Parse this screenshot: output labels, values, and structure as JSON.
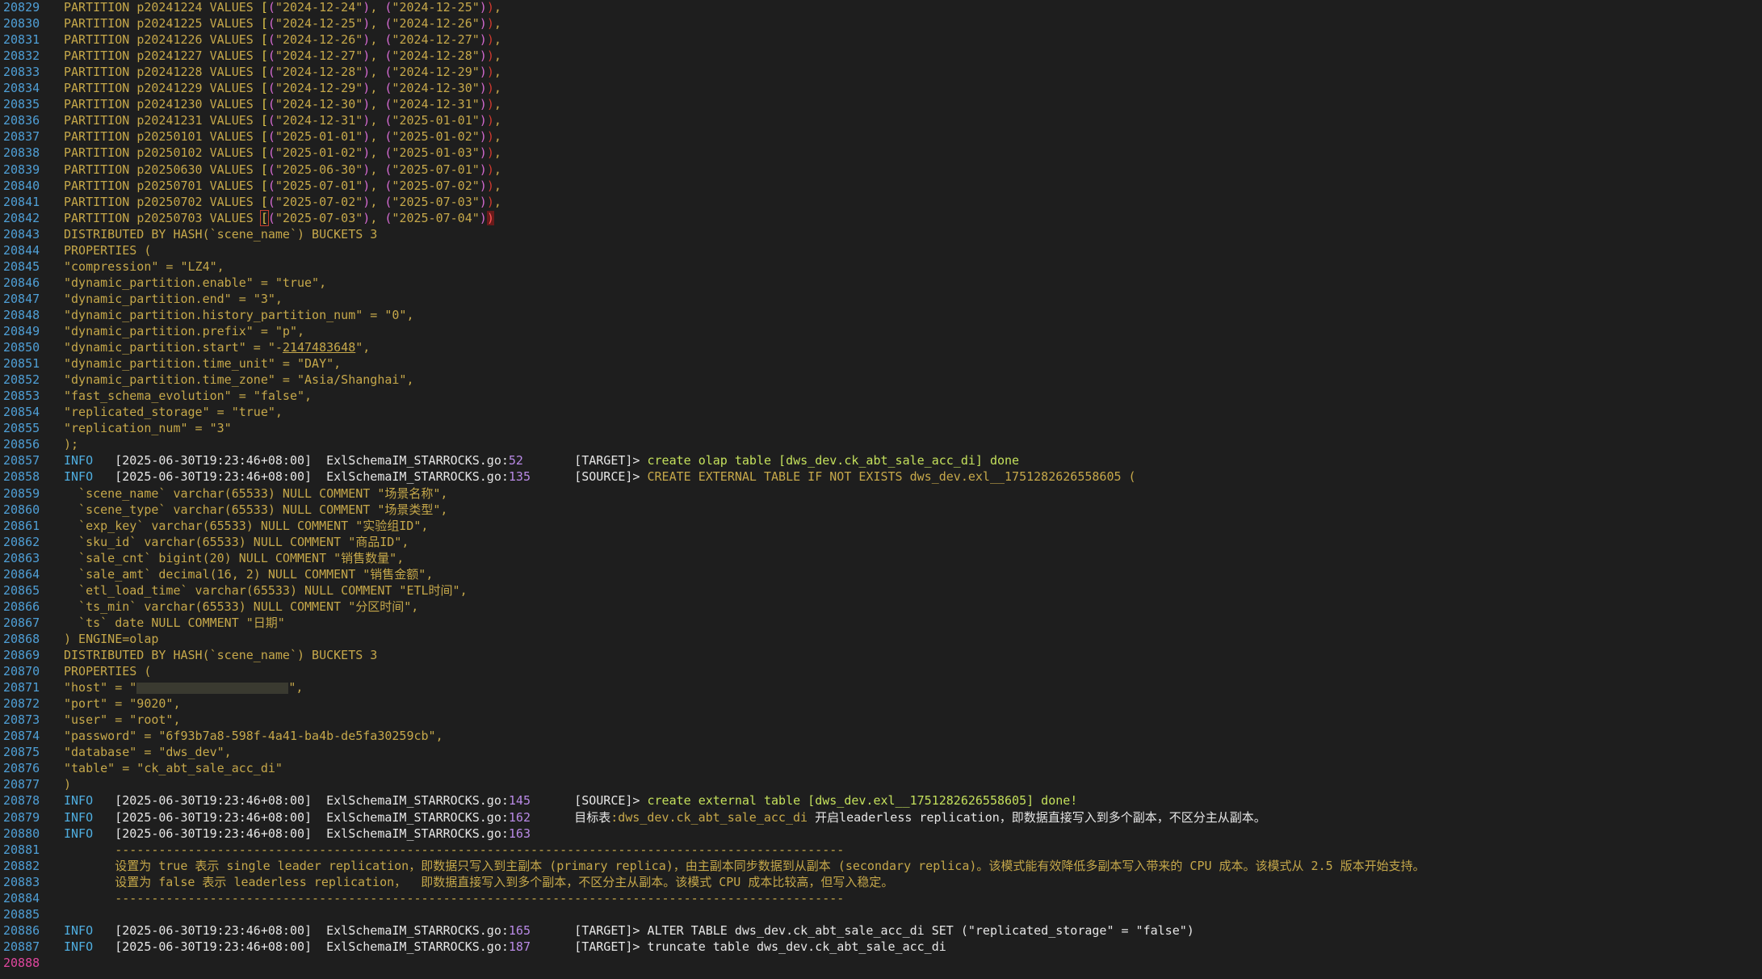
{
  "lines": [
    {
      "n": "20829",
      "kind": "part",
      "name": "p20241224",
      "a": "2024-12-24",
      "b": "2024-12-25"
    },
    {
      "n": "20830",
      "kind": "part",
      "name": "p20241225",
      "a": "2024-12-25",
      "b": "2024-12-26"
    },
    {
      "n": "20831",
      "kind": "part",
      "name": "p20241226",
      "a": "2024-12-26",
      "b": "2024-12-27"
    },
    {
      "n": "20832",
      "kind": "part",
      "name": "p20241227",
      "a": "2024-12-27",
      "b": "2024-12-28"
    },
    {
      "n": "20833",
      "kind": "part",
      "name": "p20241228",
      "a": "2024-12-28",
      "b": "2024-12-29"
    },
    {
      "n": "20834",
      "kind": "part",
      "name": "p20241229",
      "a": "2024-12-29",
      "b": "2024-12-30"
    },
    {
      "n": "20835",
      "kind": "part",
      "name": "p20241230",
      "a": "2024-12-30",
      "b": "2024-12-31"
    },
    {
      "n": "20836",
      "kind": "part",
      "name": "p20241231",
      "a": "2024-12-31",
      "b": "2025-01-01"
    },
    {
      "n": "20837",
      "kind": "part",
      "name": "p20250101",
      "a": "2025-01-01",
      "b": "2025-01-02"
    },
    {
      "n": "20838",
      "kind": "part",
      "name": "p20250102",
      "a": "2025-01-02",
      "b": "2025-01-03"
    },
    {
      "n": "20839",
      "kind": "part",
      "name": "p20250630",
      "a": "2025-06-30",
      "b": "2025-07-01"
    },
    {
      "n": "20840",
      "kind": "part",
      "name": "p20250701",
      "a": "2025-07-01",
      "b": "2025-07-02"
    },
    {
      "n": "20841",
      "kind": "part",
      "name": "p20250702",
      "a": "2025-07-02",
      "b": "2025-07-03"
    },
    {
      "n": "20842",
      "kind": "partlast",
      "name": "p20250703",
      "a": "2025-07-03",
      "b": "2025-07-04"
    },
    {
      "n": "20843",
      "kind": "text",
      "text": "DISTRIBUTED BY HASH(`scene_name`) BUCKETS 3"
    },
    {
      "n": "20844",
      "kind": "text",
      "text": "PROPERTIES ("
    },
    {
      "n": "20845",
      "kind": "text",
      "text": "\"compression\" = \"LZ4\","
    },
    {
      "n": "20846",
      "kind": "text",
      "text": "\"dynamic_partition.enable\" = \"true\","
    },
    {
      "n": "20847",
      "kind": "text",
      "text": "\"dynamic_partition.end\" = \"3\","
    },
    {
      "n": "20848",
      "kind": "text",
      "text": "\"dynamic_partition.history_partition_num\" = \"0\","
    },
    {
      "n": "20849",
      "kind": "text",
      "text": "\"dynamic_partition.prefix\" = \"p\","
    },
    {
      "n": "20850",
      "kind": "start",
      "pre": "\"dynamic_partition.start\" = \"-",
      "num": "2147483648",
      "post": "\","
    },
    {
      "n": "20851",
      "kind": "text",
      "text": "\"dynamic_partition.time_unit\" = \"DAY\","
    },
    {
      "n": "20852",
      "kind": "text",
      "text": "\"dynamic_partition.time_zone\" = \"Asia/Shanghai\","
    },
    {
      "n": "20853",
      "kind": "text",
      "text": "\"fast_schema_evolution\" = \"false\","
    },
    {
      "n": "20854",
      "kind": "text",
      "text": "\"replicated_storage\" = \"true\","
    },
    {
      "n": "20855",
      "kind": "text",
      "text": "\"replication_num\" = \"3\""
    },
    {
      "n": "20856",
      "kind": "text",
      "text": ");"
    },
    {
      "n": "20857",
      "kind": "log",
      "level": "INFO",
      "ts": "[2025-06-30T19:23:46+08:00]",
      "file": "ExlSchemaIM_STARROCKS.go",
      "line": "52",
      "tag": "[TARGET]>",
      "msg": "create olap table [dws_dev.ck_abt_sale_acc_di] done",
      "msgc": "msg-g"
    },
    {
      "n": "20858",
      "kind": "log",
      "level": "INFO",
      "ts": "[2025-06-30T19:23:46+08:00]",
      "file": "ExlSchemaIM_STARROCKS.go",
      "line": "135",
      "tag": "[SOURCE]>",
      "msg": "CREATE EXTERNAL TABLE IF NOT EXISTS dws_dev.exl__1751282626558605 (",
      "msgc": "msg-y"
    },
    {
      "n": "20859",
      "kind": "text",
      "text": "  `scene_name` varchar(65533) NULL COMMENT \"场景名称\","
    },
    {
      "n": "20860",
      "kind": "text",
      "text": "  `scene_type` varchar(65533) NULL COMMENT \"场景类型\","
    },
    {
      "n": "20861",
      "kind": "text",
      "text": "  `exp_key` varchar(65533) NULL COMMENT \"实验组ID\","
    },
    {
      "n": "20862",
      "kind": "text",
      "text": "  `sku_id` varchar(65533) NULL COMMENT \"商品ID\","
    },
    {
      "n": "20863",
      "kind": "text",
      "text": "  `sale_cnt` bigint(20) NULL COMMENT \"销售数量\","
    },
    {
      "n": "20864",
      "kind": "text",
      "text": "  `sale_amt` decimal(16, 2) NULL COMMENT \"销售金额\","
    },
    {
      "n": "20865",
      "kind": "text",
      "text": "  `etl_load_time` varchar(65533) NULL COMMENT \"ETL时间\","
    },
    {
      "n": "20866",
      "kind": "text",
      "text": "  `ts_min` varchar(65533) NULL COMMENT \"分区时间\","
    },
    {
      "n": "20867",
      "kind": "text",
      "text": "  `ts` date NULL COMMENT \"日期\""
    },
    {
      "n": "20868",
      "kind": "text",
      "text": ") ENGINE=olap"
    },
    {
      "n": "20869",
      "kind": "text",
      "text": "DISTRIBUTED BY HASH(`scene_name`) BUCKETS 3"
    },
    {
      "n": "20870",
      "kind": "text",
      "text": "PROPERTIES ("
    },
    {
      "n": "20871",
      "kind": "host",
      "pre": "\"host\" = \"",
      "post": "\","
    },
    {
      "n": "20872",
      "kind": "text",
      "text": "\"port\" = \"9020\","
    },
    {
      "n": "20873",
      "kind": "text",
      "text": "\"user\" = \"root\","
    },
    {
      "n": "20874",
      "kind": "text",
      "text": "\"password\" = \"6f93b7a8-598f-4a41-ba4b-de5fa30259cb\","
    },
    {
      "n": "20875",
      "kind": "text",
      "text": "\"database\" = \"dws_dev\","
    },
    {
      "n": "20876",
      "kind": "text",
      "text": "\"table\" = \"ck_abt_sale_acc_di\""
    },
    {
      "n": "20877",
      "kind": "text",
      "text": ")"
    },
    {
      "n": "20878",
      "kind": "log",
      "level": "INFO",
      "ts": "[2025-06-30T19:23:46+08:00]",
      "file": "ExlSchemaIM_STARROCKS.go",
      "line": "145",
      "tag": "[SOURCE]>",
      "msg": "create external table [dws_dev.exl__1751282626558605] done!",
      "msgc": "msg-g"
    },
    {
      "n": "20879",
      "kind": "log2",
      "level": "INFO",
      "ts": "[2025-06-30T19:23:46+08:00]",
      "file": "ExlSchemaIM_STARROCKS.go",
      "line": "162",
      "pre": "目标表",
      "mid": ":dws_dev.ck_abt_sale_acc_di",
      "post": " 开启leaderless replication，即数据直接写入到多个副本，不区分主从副本。"
    },
    {
      "n": "20880",
      "kind": "log",
      "level": "INFO",
      "ts": "[2025-06-30T19:23:46+08:00]",
      "file": "ExlSchemaIM_STARROCKS.go",
      "line": "163",
      "tag": "",
      "msg": "",
      "msgc": "msg-w"
    },
    {
      "n": "20881",
      "kind": "indent",
      "text": "----------------------------------------------------------------------------------------------------"
    },
    {
      "n": "20882",
      "kind": "indent",
      "text": "设置为 true 表示 single leader replication，即数据只写入到主副本 (primary replica)，由主副本同步数据到从副本 (secondary replica)。该模式能有效降低多副本写入带来的 CPU 成本。该模式从 2.5 版本开始支持。"
    },
    {
      "n": "20883",
      "kind": "indent",
      "text": "设置为 false 表示 leaderless replication，  即数据直接写入到多个副本，不区分主从副本。该模式 CPU 成本比较高，但写入稳定。"
    },
    {
      "n": "20884",
      "kind": "indent",
      "text": "----------------------------------------------------------------------------------------------------"
    },
    {
      "n": "20885",
      "kind": "text",
      "text": ""
    },
    {
      "n": "20886",
      "kind": "log",
      "level": "INFO",
      "ts": "[2025-06-30T19:23:46+08:00]",
      "file": "ExlSchemaIM_STARROCKS.go",
      "line": "165",
      "tag": "[TARGET]>",
      "msg": "ALTER TABLE dws_dev.ck_abt_sale_acc_di SET (\"replicated_storage\" = \"false\")",
      "msgc": "msg-w"
    },
    {
      "n": "20887",
      "kind": "log",
      "level": "INFO",
      "ts": "[2025-06-30T19:23:46+08:00]",
      "file": "ExlSchemaIM_STARROCKS.go",
      "line": "187",
      "tag": "[TARGET]>",
      "msg": "truncate table dws_dev.ck_abt_sale_acc_di",
      "msgc": "msg-w"
    },
    {
      "n": "20888",
      "kind": "current",
      "text": ""
    }
  ]
}
